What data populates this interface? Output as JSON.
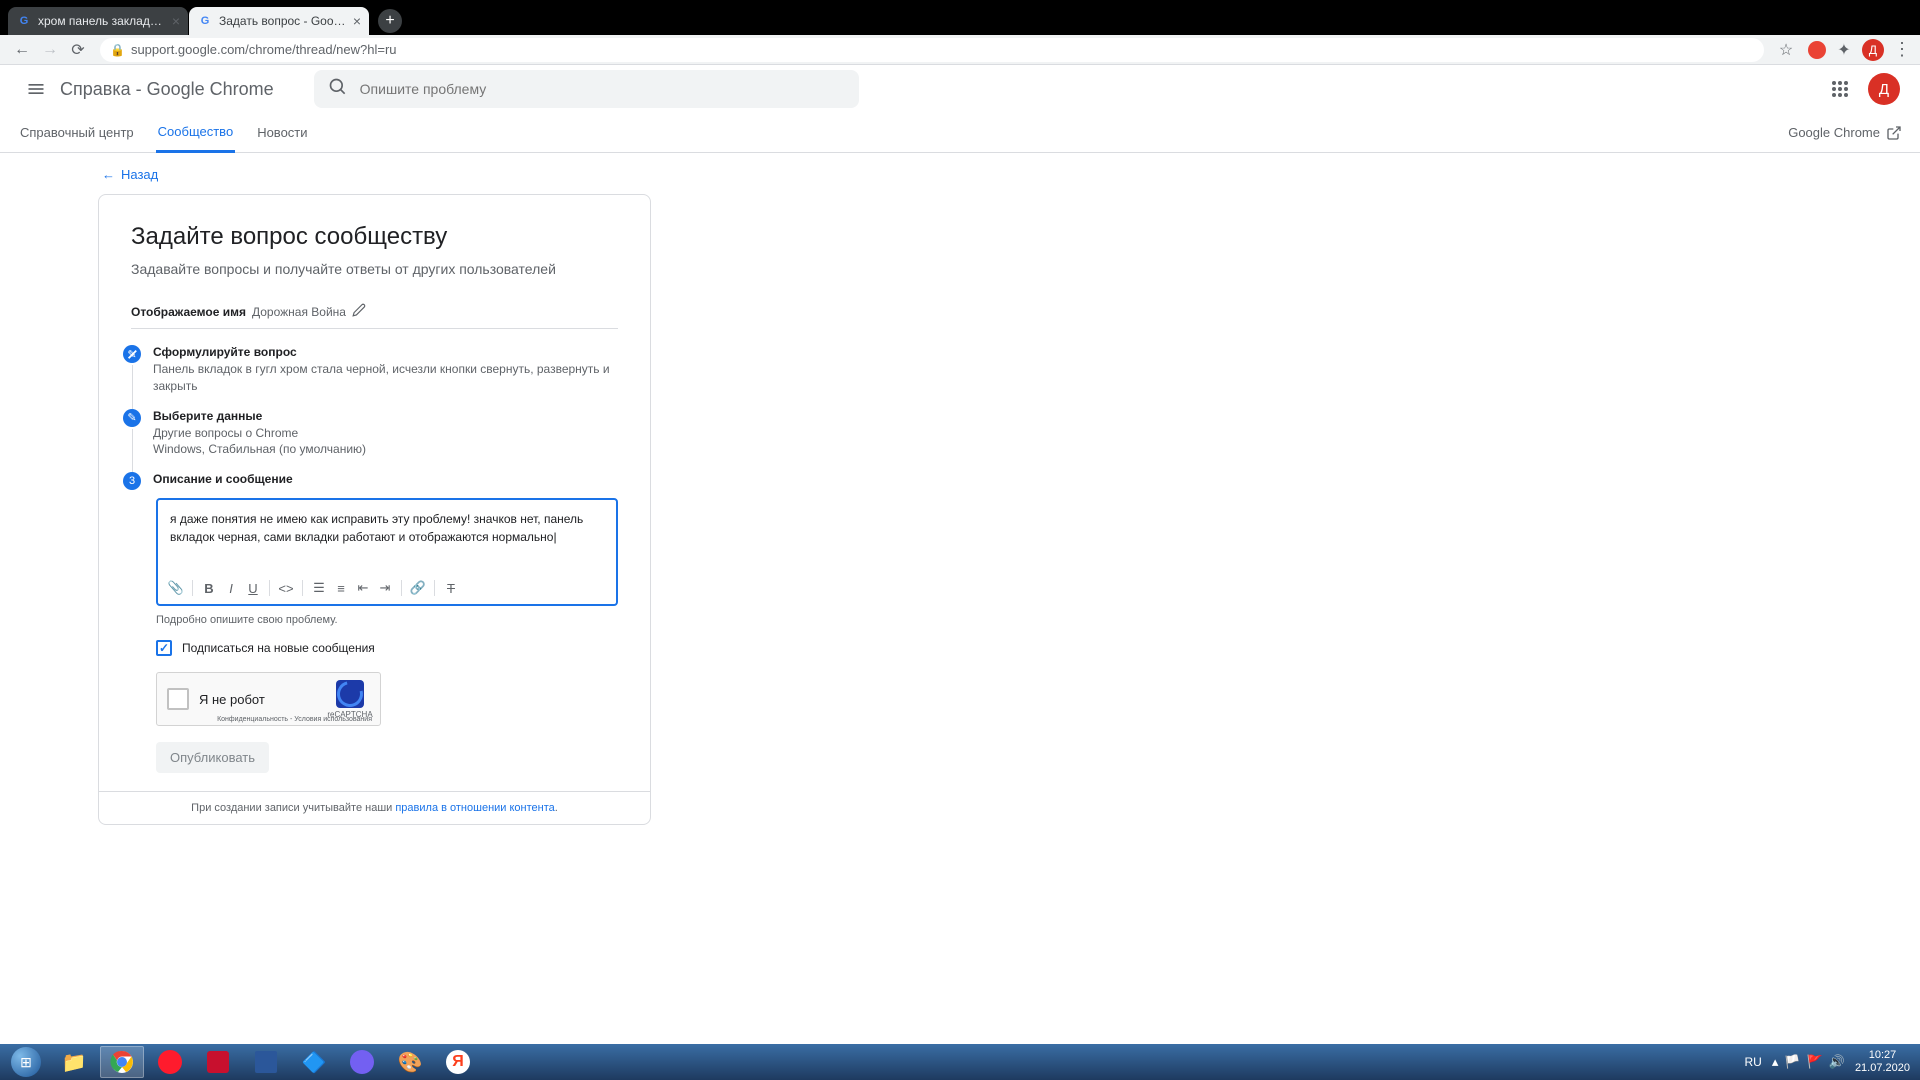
{
  "browser": {
    "tabs": [
      {
        "title": "хром панель закладок стала че…"
      },
      {
        "title": "Задать вопрос - Google Chrome"
      }
    ],
    "url": "support.google.com/chrome/thread/new?hl=ru",
    "avatar_letter": "Д"
  },
  "header": {
    "title": "Справка - Google Chrome",
    "search_placeholder": "Опишите проблему",
    "avatar_letter": "Д"
  },
  "subnav": {
    "items": [
      "Справочный центр",
      "Сообщество",
      "Новости"
    ],
    "right_label": "Google Chrome"
  },
  "content": {
    "back_label": "Назад",
    "title": "Задайте вопрос сообществу",
    "subtitle": "Задавайте вопросы и получайте ответы от других пользователей",
    "display_name_label": "Отображаемое имя",
    "display_name_value": "Дорожная Война",
    "steps": {
      "s1": {
        "title": "Сформулируйте вопрос",
        "detail": "Панель вкладок в гугл хром стала черной, исчезли кнопки свернуть, развернуть и закрыть"
      },
      "s2": {
        "title": "Выберите данные",
        "detail1": "Другие вопросы о Chrome",
        "detail2": "Windows, Стабильная (по умолчанию)"
      },
      "s3": {
        "title": "Описание и сообщение",
        "number": "3"
      }
    },
    "editor_text": "я даже понятия не имею как исправить эту проблему! значков нет, панель вкладок черная, сами вкладки работают и отображаются нормально|",
    "editor_hint": "Подробно опишите свою проблему.",
    "subscribe_label": "Подписаться на новые сообщения",
    "recaptcha": {
      "label": "Я не робот",
      "brand": "reCAPTCHA",
      "links": "Конфиденциальность - Условия использования"
    },
    "publish_label": "Опубликовать",
    "footer_text": "При создании записи учитывайте наши ",
    "footer_link": "правила в отношении контента"
  },
  "taskbar": {
    "lang": "RU",
    "time": "10:27",
    "date": "21.07.2020"
  }
}
